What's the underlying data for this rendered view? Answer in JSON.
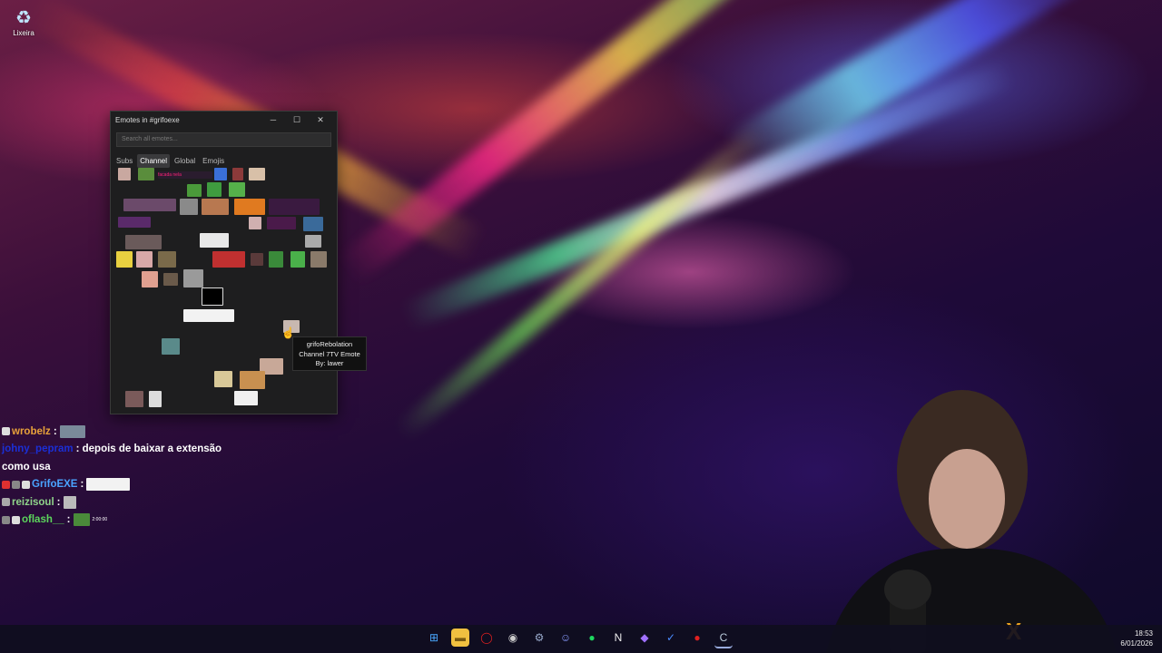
{
  "desktop": {
    "recycle_bin_label": "Lixeira"
  },
  "emote_window": {
    "title": "Emotes in #grifoexe",
    "minimize": "─",
    "maximize": "☐",
    "close": "✕",
    "search_placeholder": "Search all emotes...",
    "tabs": [
      "Subs",
      "Channel",
      "Global",
      "Emojis"
    ],
    "active_tab": "Channel",
    "inline_text_emote": "facada nela"
  },
  "tooltip": {
    "line1": "grifoRebolation",
    "line2": "Channel 7TV Emote",
    "line3": "By: lawer"
  },
  "chat": [
    {
      "name": "wrobelz",
      "name_color": "#e8a23a",
      "message": ""
    },
    {
      "name": "johny_pepram",
      "name_color": "#1b2fd6",
      "message": "depois de baixar a extensão"
    },
    {
      "name": "",
      "name_color": "#ffffff",
      "message": "como usa"
    },
    {
      "name": "GrifoEXE",
      "name_color": "#4aa3ff",
      "message": ""
    },
    {
      "name": "reizisoul",
      "name_color": "#8fd48a",
      "message": ""
    },
    {
      "name": "oflash__",
      "name_color": "#5cd65c",
      "message": ""
    }
  ],
  "chat_inline_tag": "2:00:00",
  "taskbar": {
    "icons": [
      "windows-start-icon",
      "file-explorer-icon",
      "opera-icon",
      "chrome-icon",
      "steam-icon",
      "discord-icon",
      "spotify-icon",
      "notion-icon",
      "obsidian-icon",
      "ticktick-icon",
      "record-icon",
      "chatterino-icon"
    ],
    "time": "18:53",
    "date": "6/01/2026"
  },
  "colors": {
    "window_bg": "#1e1e1f",
    "taskbar_bg": "#0f0e1e",
    "accent": "#3a3a3c"
  }
}
